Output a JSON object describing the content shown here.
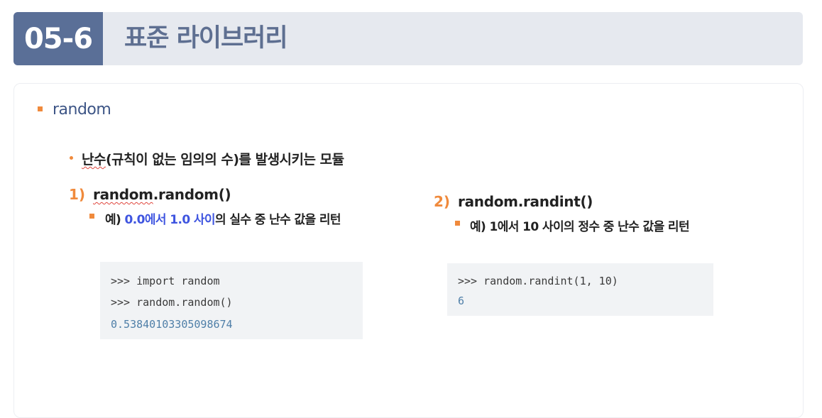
{
  "header": {
    "section_number": "05-6",
    "title": "표준 라이브러리"
  },
  "topic": "random",
  "description": {
    "part1": "난수",
    "part2": "(규칙이 없는 임의의 수)를 발생시키는 모듈"
  },
  "items": [
    {
      "number": "1)",
      "func_part1": "random",
      "func_part2": ".random()",
      "example_prefix": "예) ",
      "example_highlight": "0.0에서 1.0 사이",
      "example_suffix": "의 실수 중 난수 값을 리턴",
      "code": [
        ">>> import random",
        ">>> random.random()"
      ],
      "output": "0.53840103305098674"
    },
    {
      "number": "2)",
      "func": "random.randint()",
      "example": "예) 1에서 10 사이의 정수 중 난수 값을 리턴",
      "code": [
        ">>> random.randint(1, 10)"
      ],
      "output": "6"
    }
  ],
  "colors": {
    "header_bg": "#e6e9ef",
    "section_badge": "#5a6f97",
    "title_text": "#5e6f91",
    "accent_orange": "#f08a3c",
    "highlight_blue": "#3f55e0",
    "code_bg": "#f1f3f5",
    "output_text": "#4f7fa8"
  }
}
